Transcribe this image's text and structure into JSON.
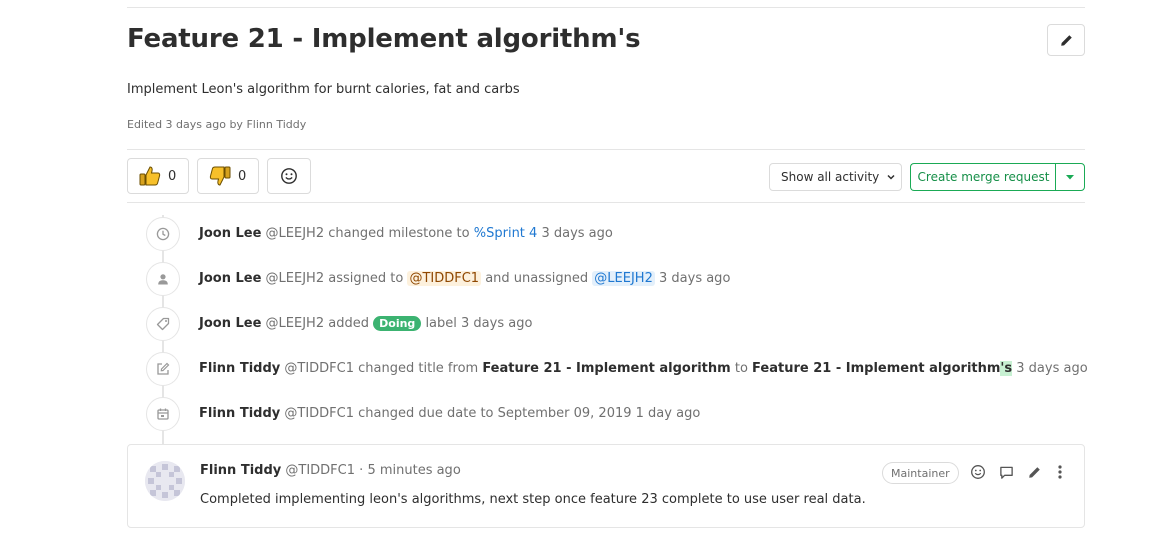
{
  "issue": {
    "title": "Feature 21 - Implement algorithm's",
    "description": "Implement Leon's algorithm for burnt calories, fat and carbs",
    "edited": "Edited 3 days ago by Flinn Tiddy"
  },
  "awards": {
    "thumbsup_count": "0",
    "thumbsdown_count": "0"
  },
  "toolbar": {
    "activity_filter": "Show all activity",
    "create_mr_label": "Create merge request"
  },
  "notes": [
    {
      "icon": "clock-icon",
      "author": "Joon Lee",
      "username": "@LEEJH2",
      "text1": "changed milestone to",
      "link": "%Sprint 4",
      "time": "3 days ago"
    },
    {
      "icon": "user-icon",
      "author": "Joon Lee",
      "username": "@LEEJH2",
      "text1": "assigned to",
      "mention1": "@TIDDFC1",
      "text2": "and unassigned",
      "mention2": "@LEEJH2",
      "time": "3 days ago"
    },
    {
      "icon": "tag-icon",
      "author": "Joon Lee",
      "username": "@LEEJH2",
      "text1": "added",
      "label": "Doing",
      "text2": "label",
      "time": "3 days ago"
    },
    {
      "icon": "pencil-square-icon",
      "author": "Flinn Tiddy",
      "username": "@TIDDFC1",
      "text1": "changed title from",
      "old_title": "Feature 21 - Implement algorithm",
      "text2": "to",
      "new_title_base": "Feature 21 - Implement algorithm",
      "new_title_added": "'s",
      "time": "3 days ago"
    },
    {
      "icon": "calendar-icon",
      "author": "Flinn Tiddy",
      "username": "@TIDDFC1",
      "text1": "changed due date to September 09, 2019",
      "time": "1 day ago"
    }
  ],
  "comment": {
    "author": "Flinn Tiddy",
    "username": "@TIDDFC1",
    "dot": "·",
    "time": "5 minutes ago",
    "role": "Maintainer",
    "body": "Completed implementing leon's algorithms, next step once feature 23 complete to use user real data."
  },
  "colors": {
    "accent_green": "#1aaa55",
    "link_blue": "#1f78d1",
    "label_doing": "#3cb371"
  }
}
